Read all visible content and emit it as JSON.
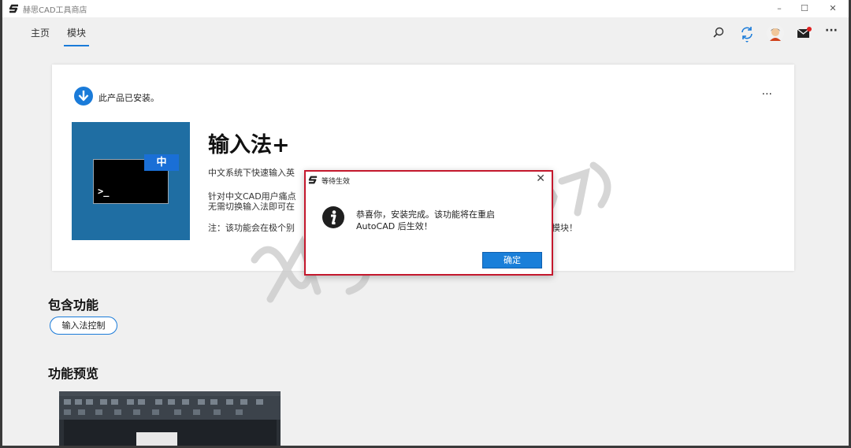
{
  "window": {
    "title": "赫思CAD工具商店",
    "minimize": "–",
    "maximize": "☐",
    "close": "✕"
  },
  "nav": {
    "tabs": [
      {
        "label": "主页",
        "active": false
      },
      {
        "label": "模块",
        "active": true
      }
    ],
    "more": "···",
    "accent": "#1a7bd9"
  },
  "product": {
    "status": "此产品已安装。",
    "more": "···",
    "title": "输入法+",
    "badge": "中",
    "prompt": ">_",
    "lines": [
      "中文系统下快速输入英",
      "针对中文CAD用户痛点",
      "无需切换输入法即可在",
      "注：该功能会在极个别"
    ],
    "line4_tail": "此模块！"
  },
  "features": {
    "heading": "包含功能",
    "chip": "输入法控制"
  },
  "preview": {
    "heading": "功能预览"
  },
  "dialog": {
    "title": "等待生效",
    "close": "✕",
    "message_line1": "恭喜你，安装完成。该功能将在重启",
    "message_line2": "AutoCAD 后生效！",
    "ok": "确定",
    "highlight": "#c4182d",
    "button_color": "#1a7fd9"
  }
}
